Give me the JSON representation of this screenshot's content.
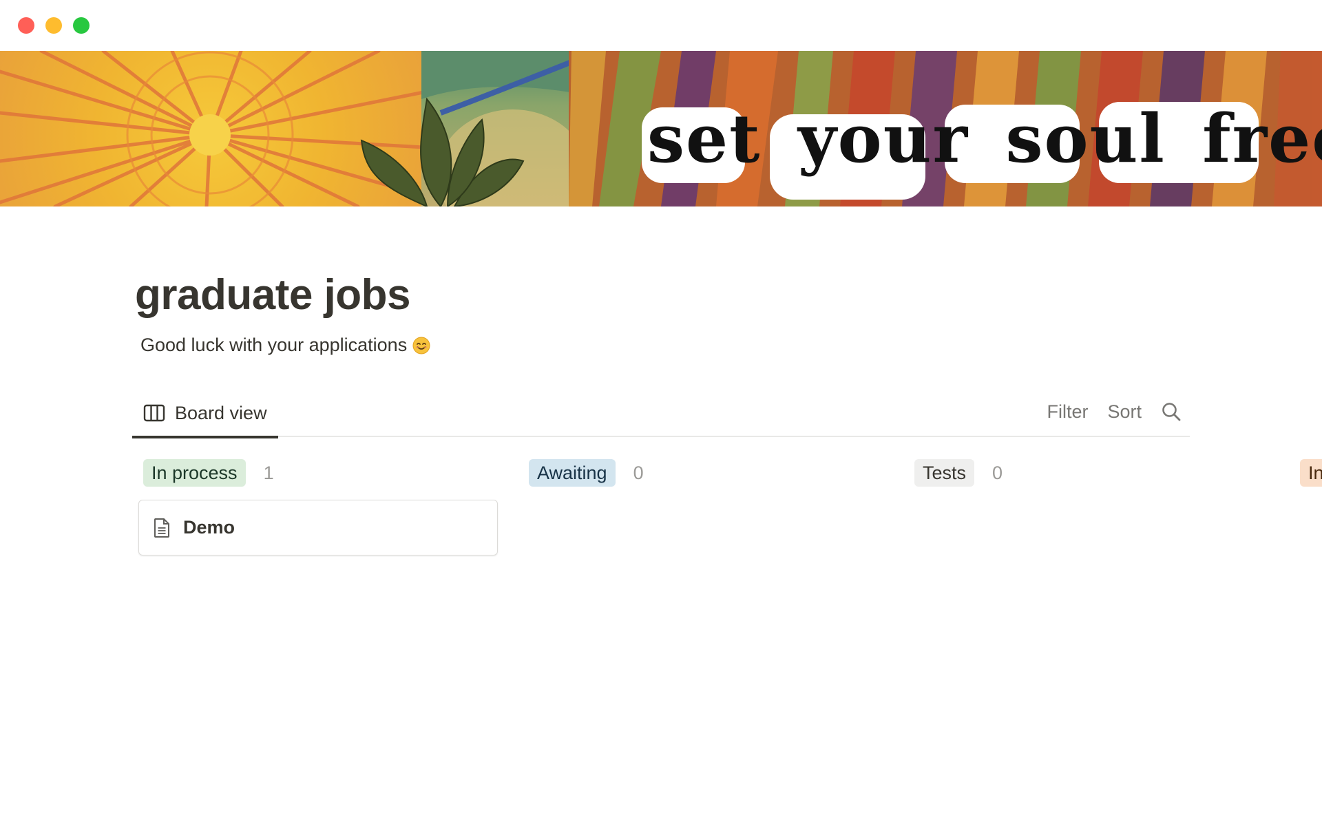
{
  "window": {
    "controls": [
      "close",
      "minimize",
      "maximize"
    ]
  },
  "cover": {
    "quote": "set your soul free."
  },
  "page": {
    "title": "graduate jobs",
    "subtitle": "Good luck with your applications",
    "subtitle_emoji": "smiling-face"
  },
  "views": {
    "active_tab": {
      "label": "Board view",
      "icon": "board-icon"
    },
    "toolbar": {
      "filter_label": "Filter",
      "sort_label": "Sort",
      "search_icon": "search-icon"
    }
  },
  "board": {
    "columns": [
      {
        "label": "In process",
        "count": "1",
        "color": "#dbeddb",
        "text_color": "#1c3829"
      },
      {
        "label": "Awaiting",
        "count": "0",
        "color": "#d3e5ef",
        "text_color": "#183347"
      },
      {
        "label": "Tests",
        "count": "0",
        "color": "#efefee",
        "text_color": "#37352f"
      },
      {
        "label": "In",
        "count": "",
        "color": "#fadec9",
        "text_color": "#49290e"
      }
    ],
    "cards": [
      {
        "column": "In process",
        "title": "Demo",
        "icon": "page-icon"
      }
    ]
  },
  "colors": {
    "text": "#37352f",
    "muted": "#787774",
    "divider": "#e9e9e7"
  }
}
